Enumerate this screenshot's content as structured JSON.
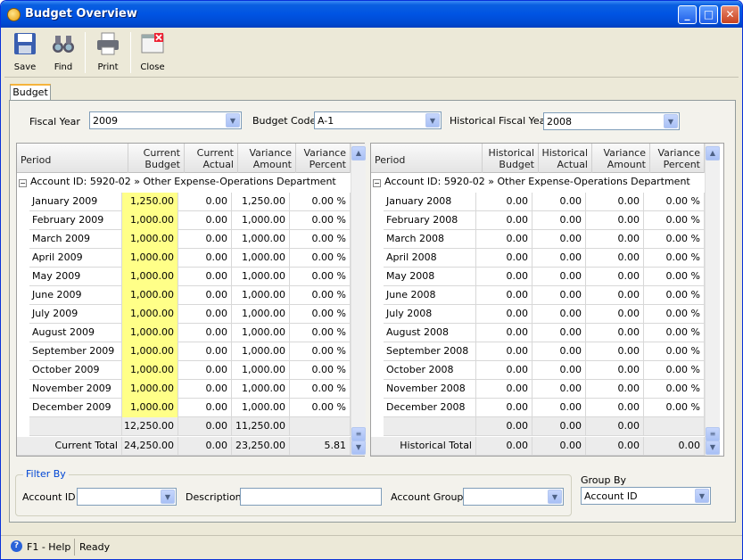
{
  "window": {
    "title": "Budget Overview"
  },
  "toolbar": {
    "save": "Save",
    "find": "Find",
    "print": "Print",
    "close": "Close"
  },
  "tab": "Budget",
  "filters": {
    "fiscal_year_label": "Fiscal Year",
    "fiscal_year": "2009",
    "budget_code_label": "Budget Code",
    "budget_code": "A-1",
    "hist_year_label": "Historical Fiscal Year",
    "hist_year": "2008"
  },
  "left_grid": {
    "headers": [
      "Period",
      "Current Budget",
      "Current Actual",
      "Variance Amount",
      "Variance Percent"
    ],
    "group": "Account ID: 5920-02 » Other Expense-Operations Department",
    "rows": [
      [
        "January 2009",
        "1,250.00",
        "0.00",
        "1,250.00",
        "0.00 %"
      ],
      [
        "February 2009",
        "1,000.00",
        "0.00",
        "1,000.00",
        "0.00 %"
      ],
      [
        "March 2009",
        "1,000.00",
        "0.00",
        "1,000.00",
        "0.00 %"
      ],
      [
        "April 2009",
        "1,000.00",
        "0.00",
        "1,000.00",
        "0.00 %"
      ],
      [
        "May 2009",
        "1,000.00",
        "0.00",
        "1,000.00",
        "0.00 %"
      ],
      [
        "June 2009",
        "1,000.00",
        "0.00",
        "1,000.00",
        "0.00 %"
      ],
      [
        "July 2009",
        "1,000.00",
        "0.00",
        "1,000.00",
        "0.00 %"
      ],
      [
        "August 2009",
        "1,000.00",
        "0.00",
        "1,000.00",
        "0.00 %"
      ],
      [
        "September 2009",
        "1,000.00",
        "0.00",
        "1,000.00",
        "0.00 %"
      ],
      [
        "October 2009",
        "1,000.00",
        "0.00",
        "1,000.00",
        "0.00 %"
      ],
      [
        "November 2009",
        "1,000.00",
        "0.00",
        "1,000.00",
        "0.00 %"
      ],
      [
        "December 2009",
        "1,000.00",
        "0.00",
        "1,000.00",
        "0.00 %"
      ]
    ],
    "subtotal": [
      "",
      "12,250.00",
      "0.00",
      "11,250.00",
      ""
    ],
    "total": [
      "Current Total",
      "24,250.00",
      "0.00",
      "23,250.00",
      "5.81"
    ]
  },
  "right_grid": {
    "headers": [
      "Period",
      "Historical Budget",
      "Historical Actual",
      "Variance Amount",
      "Variance Percent"
    ],
    "group": "Account ID: 5920-02 » Other Expense-Operations Department",
    "rows": [
      [
        "January 2008",
        "0.00",
        "0.00",
        "0.00",
        "0.00 %"
      ],
      [
        "February 2008",
        "0.00",
        "0.00",
        "0.00",
        "0.00 %"
      ],
      [
        "March 2008",
        "0.00",
        "0.00",
        "0.00",
        "0.00 %"
      ],
      [
        "April 2008",
        "0.00",
        "0.00",
        "0.00",
        "0.00 %"
      ],
      [
        "May 2008",
        "0.00",
        "0.00",
        "0.00",
        "0.00 %"
      ],
      [
        "June 2008",
        "0.00",
        "0.00",
        "0.00",
        "0.00 %"
      ],
      [
        "July 2008",
        "0.00",
        "0.00",
        "0.00",
        "0.00 %"
      ],
      [
        "August 2008",
        "0.00",
        "0.00",
        "0.00",
        "0.00 %"
      ],
      [
        "September 2008",
        "0.00",
        "0.00",
        "0.00",
        "0.00 %"
      ],
      [
        "October 2008",
        "0.00",
        "0.00",
        "0.00",
        "0.00 %"
      ],
      [
        "November 2008",
        "0.00",
        "0.00",
        "0.00",
        "0.00 %"
      ],
      [
        "December 2008",
        "0.00",
        "0.00",
        "0.00",
        "0.00 %"
      ]
    ],
    "subtotal": [
      "",
      "0.00",
      "0.00",
      "0.00",
      ""
    ],
    "total": [
      "Historical Total",
      "0.00",
      "0.00",
      "0.00",
      "0.00"
    ]
  },
  "filter_by": {
    "legend": "Filter By",
    "account_id_label": "Account ID",
    "description_label": "Description",
    "account_group_label": "Account Group",
    "account_id": "",
    "description": "",
    "account_group": ""
  },
  "group_by": {
    "label": "Group By",
    "value": "Account ID"
  },
  "status": {
    "help": "F1 - Help",
    "state": "Ready"
  }
}
